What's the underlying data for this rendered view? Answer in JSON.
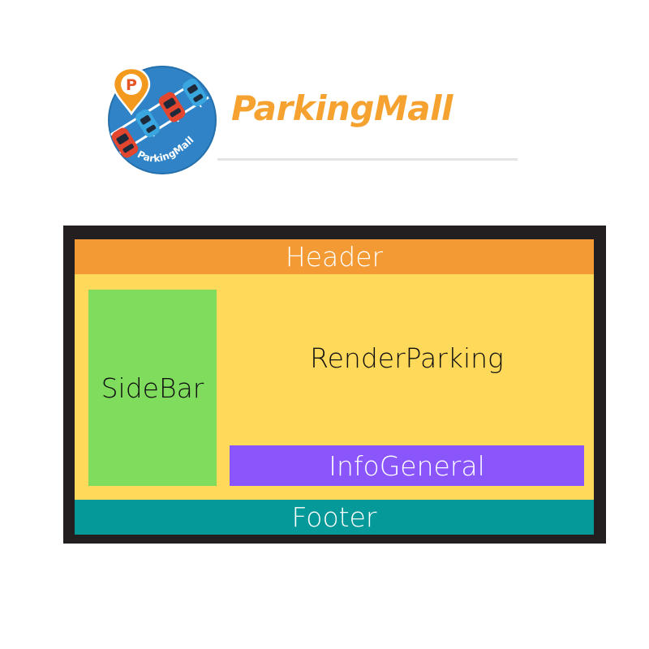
{
  "logo": {
    "brand_name": "ParkingMall",
    "badge_text": "ParkingMall",
    "pin_letter": "P",
    "colors": {
      "brand_orange": "#f5a230",
      "badge_blue": "#2f83c6",
      "car_red": "#e3462f",
      "car_blue": "#3aa6e0",
      "pin_orange": "#f39a1e"
    }
  },
  "diagram": {
    "header": {
      "label": "Header",
      "color": "#f49a35",
      "text_color": "#ffffff"
    },
    "main": {
      "color": "#fed95a"
    },
    "sidebar": {
      "label": "SideBar",
      "color": "#7fdc5d",
      "text_color": "#111111"
    },
    "render_parking": {
      "label": "RenderParking",
      "text_color": "#111111"
    },
    "info_general": {
      "label": "InfoGeneral",
      "color": "#8b55fc",
      "text_color": "#ffffff"
    },
    "footer": {
      "label": "Footer",
      "color": "#06999a",
      "text_color": "#ffffff"
    },
    "frame_color": "#231f20"
  }
}
